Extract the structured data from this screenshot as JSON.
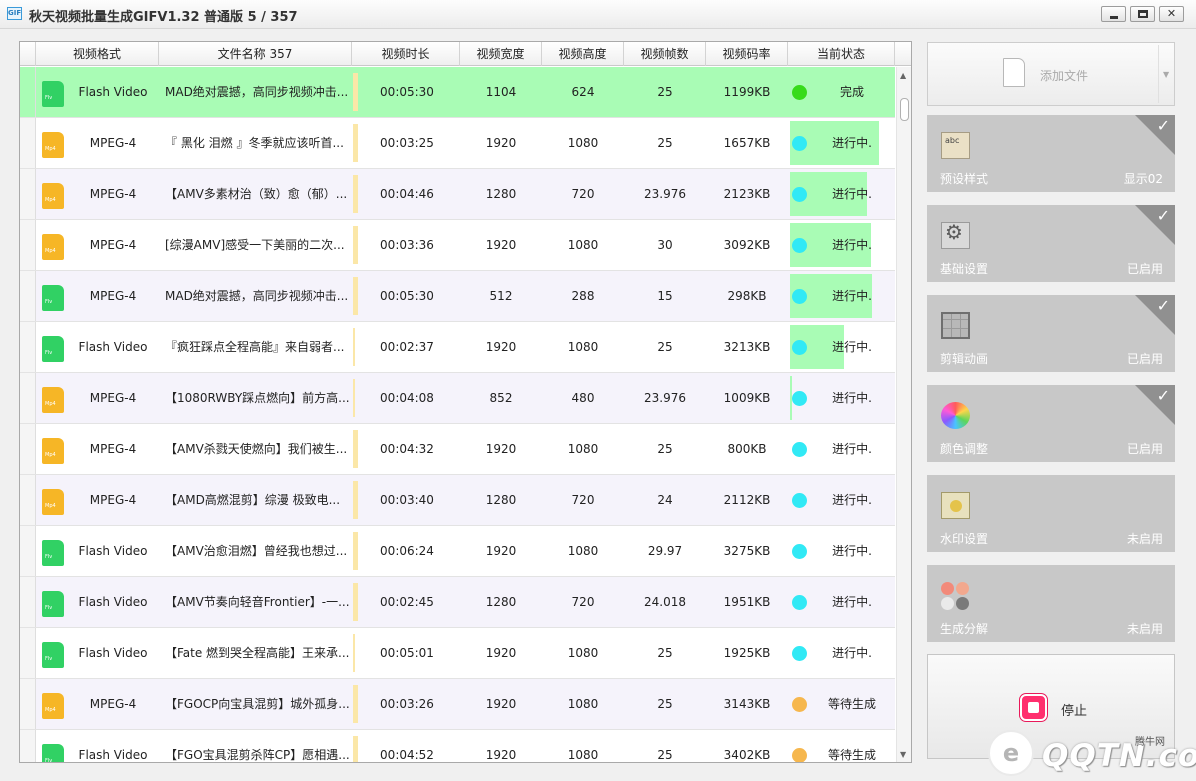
{
  "window": {
    "icon_label": "GIF",
    "title": "秋天视频批量生成GIFV1.32 普通版 5 / 357",
    "close_glyph": "✕"
  },
  "table": {
    "columns": [
      "视频格式",
      "文件名称 357",
      "视频时长",
      "视频宽度",
      "视频高度",
      "视频帧数",
      "视频码率",
      "当前状态"
    ],
    "rows": [
      {
        "icon": "flv-file-icon",
        "format": "Flash Video",
        "name": "MAD绝对震撼，高同步视频冲击...",
        "duration": "00:05:30",
        "width": "1104",
        "height": "624",
        "fps": "25",
        "bitrate": "1199KB",
        "status": "完成",
        "progress": 1.0
      },
      {
        "icon": "mp4-file-icon",
        "format": "MPEG-4",
        "name": "『 黑化  泪燃 』冬季就应该听首...",
        "duration": "00:03:25",
        "width": "1920",
        "height": "1080",
        "fps": "25",
        "bitrate": "1657KB",
        "status": "进行中.",
        "progress": 0.85
      },
      {
        "icon": "mp4-file-icon",
        "format": "MPEG-4",
        "name": "【AMV多素材治（致）愈（郁）...",
        "duration": "00:04:46",
        "width": "1280",
        "height": "720",
        "fps": "23.976",
        "bitrate": "2123KB",
        "status": "进行中.",
        "progress": 0.73
      },
      {
        "icon": "mp4-file-icon",
        "format": "MPEG-4",
        "name": "[综漫AMV]感受一下美丽的二次...",
        "duration": "00:03:36",
        "width": "1920",
        "height": "1080",
        "fps": "30",
        "bitrate": "3092KB",
        "status": "进行中.",
        "progress": 0.77
      },
      {
        "icon": "flv-file-icon",
        "format": "MPEG-4",
        "name": "MAD绝对震撼，高同步视频冲击...",
        "duration": "00:05:30",
        "width": "512",
        "height": "288",
        "fps": "15",
        "bitrate": "298KB",
        "status": "进行中.",
        "progress": 0.78
      },
      {
        "icon": "flv-file-icon",
        "format": "Flash Video",
        "name": "『疯狂踩点全程高能』来自弱者...",
        "duration": "00:02:37",
        "width": "1920",
        "height": "1080",
        "fps": "25",
        "bitrate": "3213KB",
        "status": "进行中.",
        "progress": 0.51
      },
      {
        "icon": "mp4-file-icon",
        "format": "MPEG-4",
        "name": "【1080RWBY踩点燃向】前方高...",
        "duration": "00:04:08",
        "width": "852",
        "height": "480",
        "fps": "23.976",
        "bitrate": "1009KB",
        "status": "进行中.",
        "progress": 0.02
      },
      {
        "icon": "mp4-file-icon",
        "format": "MPEG-4",
        "name": "【AMV杀戮天使燃向】我们被生...",
        "duration": "00:04:32",
        "width": "1920",
        "height": "1080",
        "fps": "25",
        "bitrate": "800KB",
        "status": "进行中.",
        "progress": 0
      },
      {
        "icon": "mp4-file-icon",
        "format": "MPEG-4",
        "name": "【AMD高燃混剪】综漫   极致电...",
        "duration": "00:03:40",
        "width": "1280",
        "height": "720",
        "fps": "24",
        "bitrate": "2112KB",
        "status": "进行中.",
        "progress": 0
      },
      {
        "icon": "flv-file-icon",
        "format": "Flash Video",
        "name": "【AMV治愈泪燃】曾经我也想过...",
        "duration": "00:06:24",
        "width": "1920",
        "height": "1080",
        "fps": "29.97",
        "bitrate": "3275KB",
        "status": "进行中.",
        "progress": 0
      },
      {
        "icon": "flv-file-icon",
        "format": "Flash Video",
        "name": "【AMV节奏向轻音Frontier】-一...",
        "duration": "00:02:45",
        "width": "1280",
        "height": "720",
        "fps": "24.018",
        "bitrate": "1951KB",
        "status": "进行中.",
        "progress": 0
      },
      {
        "icon": "flv-file-icon",
        "format": "Flash Video",
        "name": "【Fate 燃到哭全程高能】王来承...",
        "duration": "00:05:01",
        "width": "1920",
        "height": "1080",
        "fps": "25",
        "bitrate": "1925KB",
        "status": "进行中.",
        "progress": 0
      },
      {
        "icon": "mp4-file-icon",
        "format": "MPEG-4",
        "name": "【FGOCP向宝具混剪】城外孤身...",
        "duration": "00:03:26",
        "width": "1920",
        "height": "1080",
        "fps": "25",
        "bitrate": "3143KB",
        "status": "等待生成",
        "progress": 0
      },
      {
        "icon": "flv-file-icon",
        "format": "Flash Video",
        "name": "【FGO宝具混剪杀阵CP】愿相遇...",
        "duration": "00:04:52",
        "width": "1920",
        "height": "1080",
        "fps": "25",
        "bitrate": "3402KB",
        "status": "等待生成",
        "progress": 0
      }
    ]
  },
  "sidebar": {
    "add_file_label": "添加文件",
    "cards": [
      {
        "icon": "text-style-icon",
        "name": "预设样式",
        "status": "显示02",
        "checked": true
      },
      {
        "icon": "gear-settings-icon",
        "name": "基础设置",
        "status": "已启用",
        "checked": true
      },
      {
        "icon": "grid-animation-icon",
        "name": "剪辑动画",
        "status": "已启用",
        "checked": true
      },
      {
        "icon": "color-wheel-icon",
        "name": "颜色调整",
        "status": "已启用",
        "checked": true
      },
      {
        "icon": "watermark-image-icon",
        "name": "水印设置",
        "status": "未启用",
        "checked": false
      },
      {
        "icon": "color-split-icon",
        "name": "生成分解",
        "status": "未启用",
        "checked": false
      }
    ],
    "stop_label": "停止"
  },
  "watermark": {
    "brand": "QQTN.com",
    "cn": "腾牛网"
  },
  "colors": {
    "done_row": "#a9fcb5",
    "dot_done": "#37db1b",
    "dot_running": "#31e9f5",
    "dot_waiting": "#f6b74e",
    "stop_button": "#ff2f6e"
  }
}
